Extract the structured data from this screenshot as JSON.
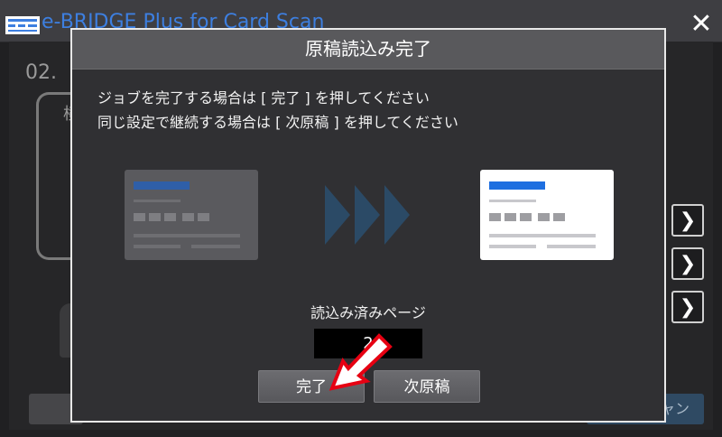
{
  "app": {
    "title": "e-BRIDGE Plus for Card Scan",
    "close_glyph": "✕"
  },
  "background": {
    "code_partial": "02.",
    "card_char": "横",
    "left_button_char": "横",
    "right_button_label": "ャン",
    "chevron_glyph": "❯"
  },
  "dialog": {
    "title": "原稿読込み完了",
    "message_line1": "ジョブを完了する場合は [ 完了 ] を押してください",
    "message_line2": "同じ設定で継続する場合は [ 次原稿 ] を押してください",
    "pages_label": "読込み済みページ",
    "pages_count": "2",
    "done_button": "完了",
    "next_button": "次原稿"
  },
  "colors": {
    "accent_blue": "#1e6fe0",
    "dim_card": "#5a5a5e",
    "arrow_red": "#e60012"
  }
}
